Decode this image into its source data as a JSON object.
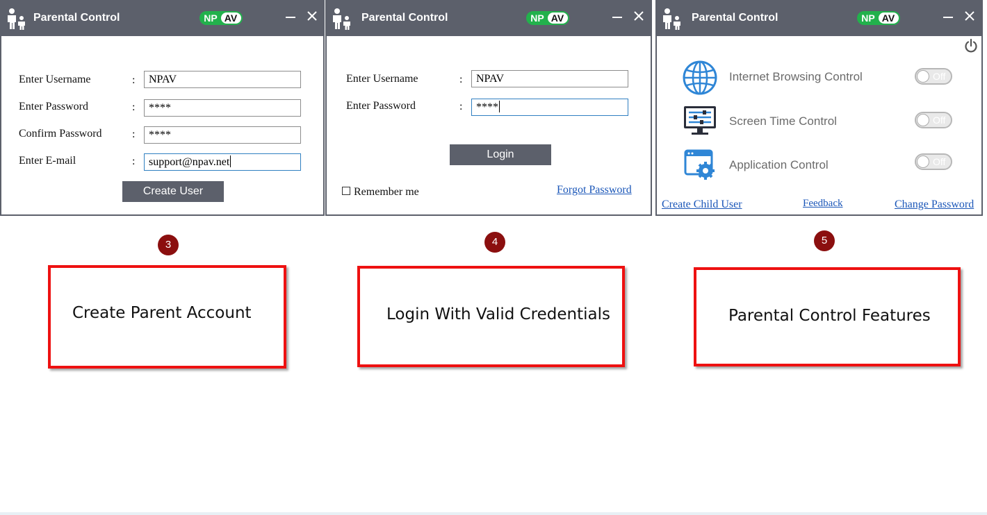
{
  "windows": [
    {
      "title": "Parental Control",
      "logo": {
        "left": "NP",
        "right": "AV"
      },
      "form": {
        "username_label": "Enter Username",
        "password_label": "Enter Password",
        "confirm_label": "Confirm Password",
        "email_label": "Enter E-mail",
        "colon": ":",
        "username_value": "NPAV",
        "password_value": "****",
        "confirm_value": "****",
        "email_value": "support@npav.net"
      },
      "button_label": "Create User"
    },
    {
      "title": "Parental Control",
      "logo": {
        "left": "NP",
        "right": "AV"
      },
      "form": {
        "username_label": "Enter Username",
        "password_label": "Enter Password",
        "colon": ":",
        "username_value": "NPAV",
        "password_value": "****"
      },
      "button_label": "Login",
      "remember_label": "Remember me",
      "remember_checked": false,
      "forgot_link": "Forgot Password"
    },
    {
      "title": "Parental Control",
      "logo": {
        "left": "NP",
        "right": "AV"
      },
      "features": [
        {
          "icon": "globe-icon",
          "label": "Internet Browsing Control",
          "state": "Off"
        },
        {
          "icon": "screen-sliders-icon",
          "label": "Screen Time Control",
          "state": "Off"
        },
        {
          "icon": "app-gear-icon",
          "label": "Application Control",
          "state": "Off"
        }
      ],
      "links": {
        "create_child": "Create Child User",
        "feedback": "Feedback",
        "change_password": "Change Password"
      }
    }
  ],
  "steps": [
    {
      "number": "3",
      "caption": "Create Parent Account"
    },
    {
      "number": "4",
      "caption": "Login With Valid Credentials"
    },
    {
      "number": "5",
      "caption": "Parental Control Features"
    }
  ],
  "colors": {
    "titlebar": "#5c606b",
    "logo_green": "#22b14c",
    "step_badge": "#8b0f0f",
    "red_border": "#ee1111",
    "link": "#1a56b8",
    "feature_icon_blue": "#2f86d6"
  }
}
